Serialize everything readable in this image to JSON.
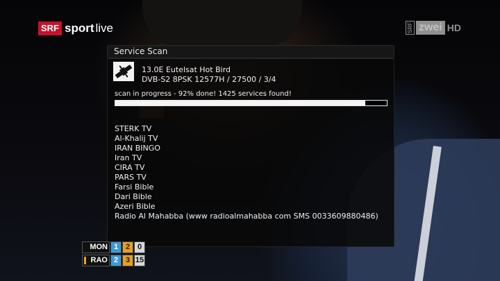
{
  "broadcast": {
    "left_logo": {
      "box": "SRF",
      "sport": "sport",
      "live": "live"
    },
    "right_logo": {
      "srf": "SRF",
      "zwei": "zwei",
      "hd": "HD"
    }
  },
  "dialog": {
    "title": "Service Scan",
    "satellite_icon": "satellite-icon",
    "satellite_name": "13.0E Eutelsat Hot Bird",
    "transponder": "DVB-S2 8PSK 12577H / 27500 / 3/4",
    "status": "scan in progress - 92% done! 1425 services found!",
    "progress_percent": 92,
    "services": [
      "STERK TV",
      "Al-Khalij TV",
      "IRAN BINGO",
      "Iran TV",
      "CIRA TV",
      "PARS TV",
      "Farsi Bible",
      "Dari Bible",
      "Azeri Bible",
      "Radio Al Mahabba (www radioalmahabba com SMS 0033609880486)"
    ]
  },
  "scoreboard": {
    "rows": [
      {
        "player": "MON",
        "set1": "1",
        "set2": "2",
        "game": "0"
      },
      {
        "player": "RAO",
        "set1": "2",
        "set2": "3",
        "game": "15"
      }
    ],
    "colors": {
      "set1": "#3a9ad8",
      "set2": "#e8a020",
      "game": "#d8d8d8",
      "serve": "#f0a020"
    }
  }
}
